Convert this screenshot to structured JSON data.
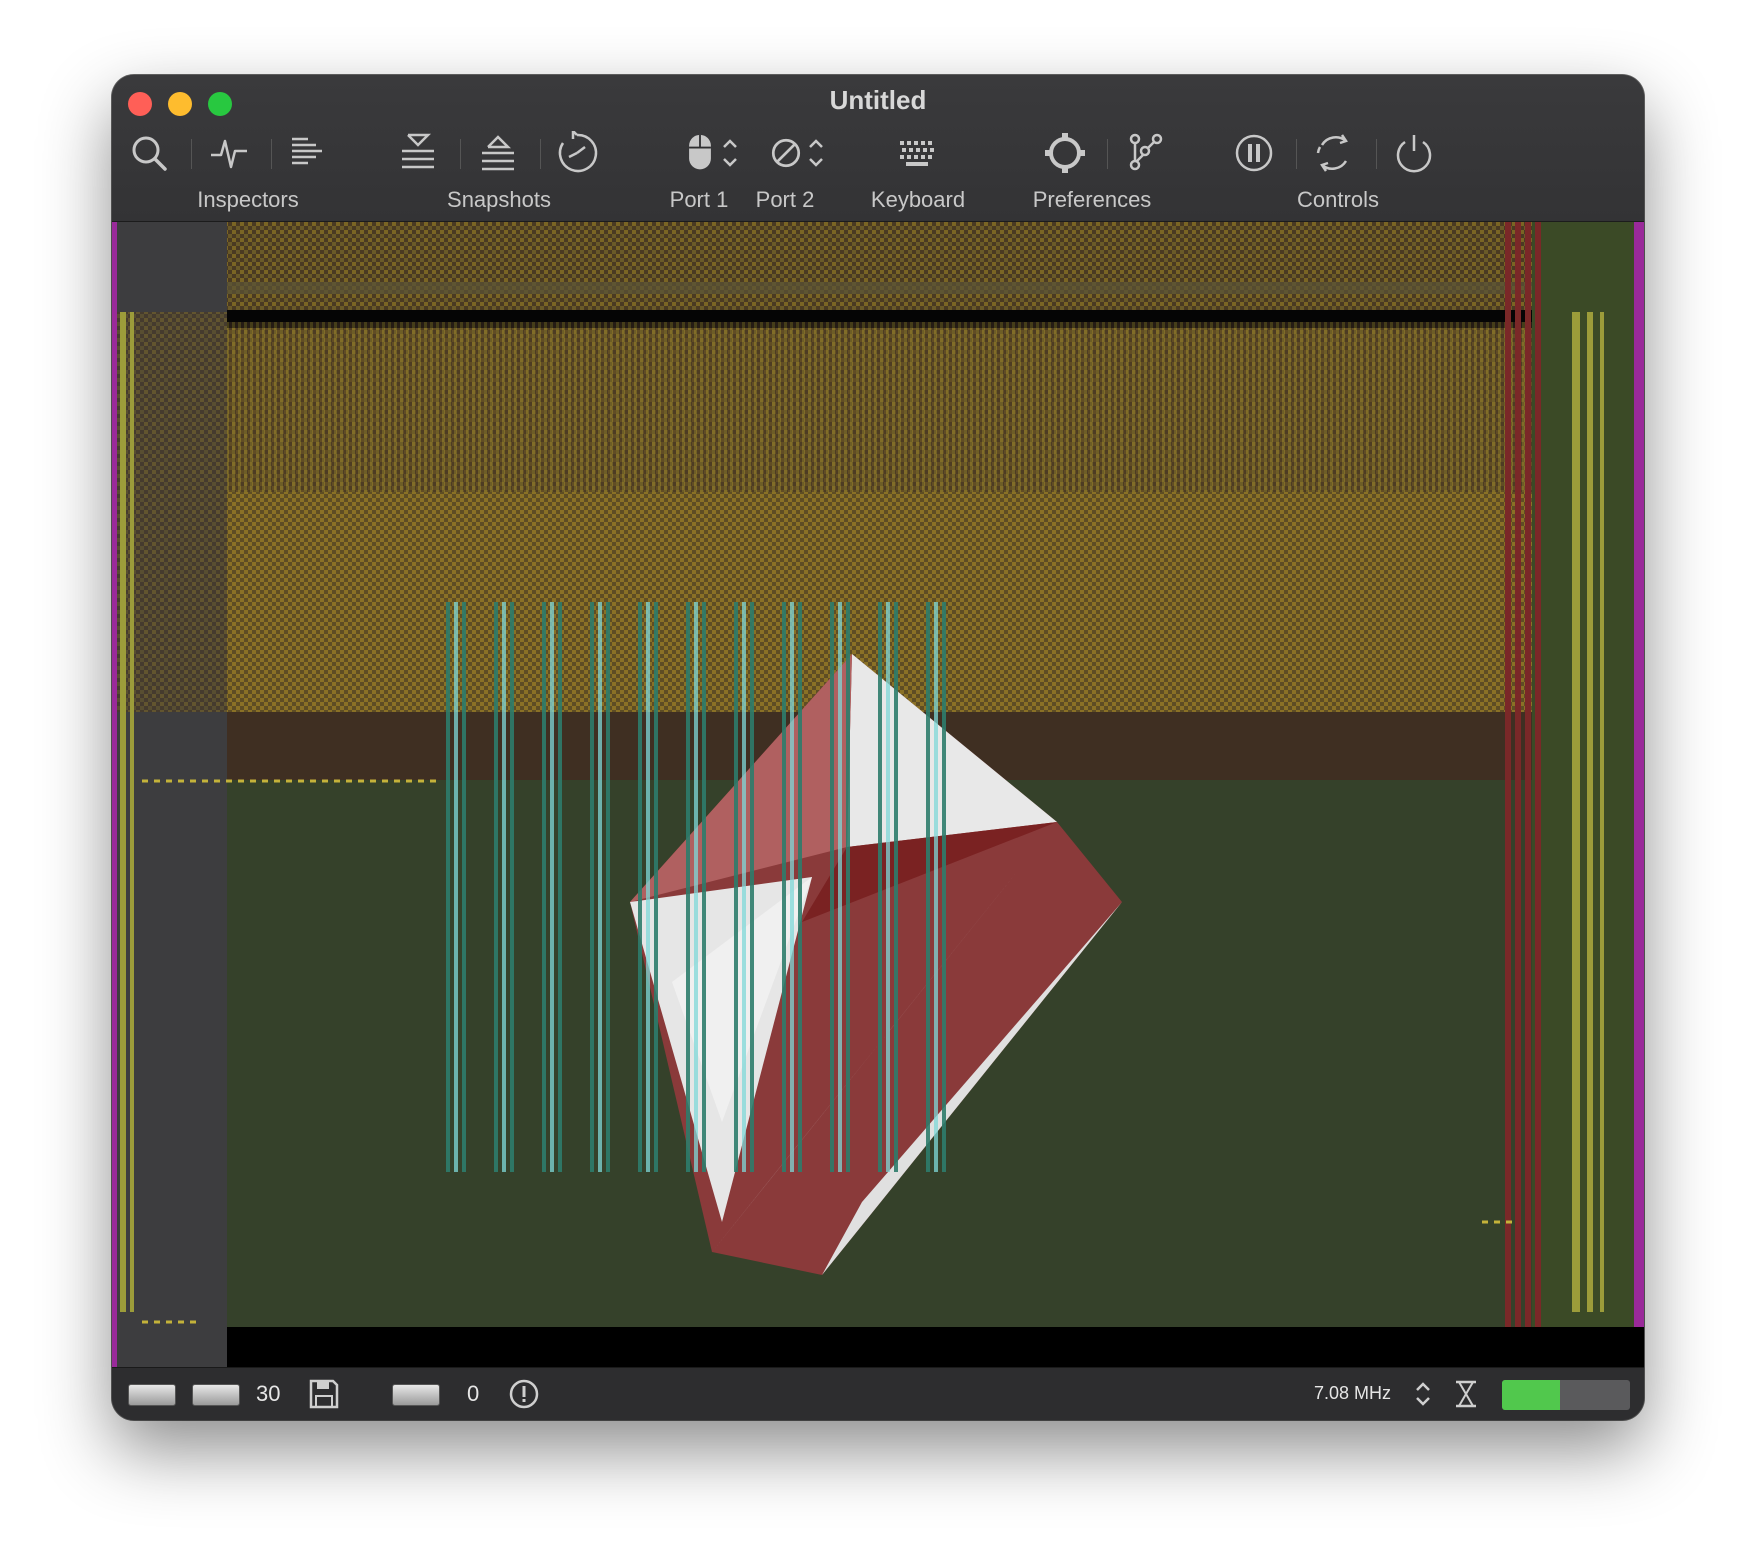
{
  "window": {
    "title": "Untitled"
  },
  "toolbar": {
    "groups": [
      {
        "label": "Inspectors"
      },
      {
        "label": "Snapshots"
      },
      {
        "label": "Port 1"
      },
      {
        "label": "Port 2"
      },
      {
        "label": "Keyboard"
      },
      {
        "label": "Preferences"
      },
      {
        "label": "Controls"
      }
    ]
  },
  "statusbar": {
    "drive1_count": "30",
    "drive2_count": "0",
    "clock": "7.08 MHz",
    "speed_level": 0.45,
    "speed_color": "#51c84d"
  },
  "emulator_screen": {
    "border_color": "#35412a",
    "palette": [
      "#35412a",
      "#3f2f22",
      "#8a7126",
      "#2e7c6c",
      "#7a2828",
      "#e8e8e8",
      "#9a2a9a"
    ]
  }
}
